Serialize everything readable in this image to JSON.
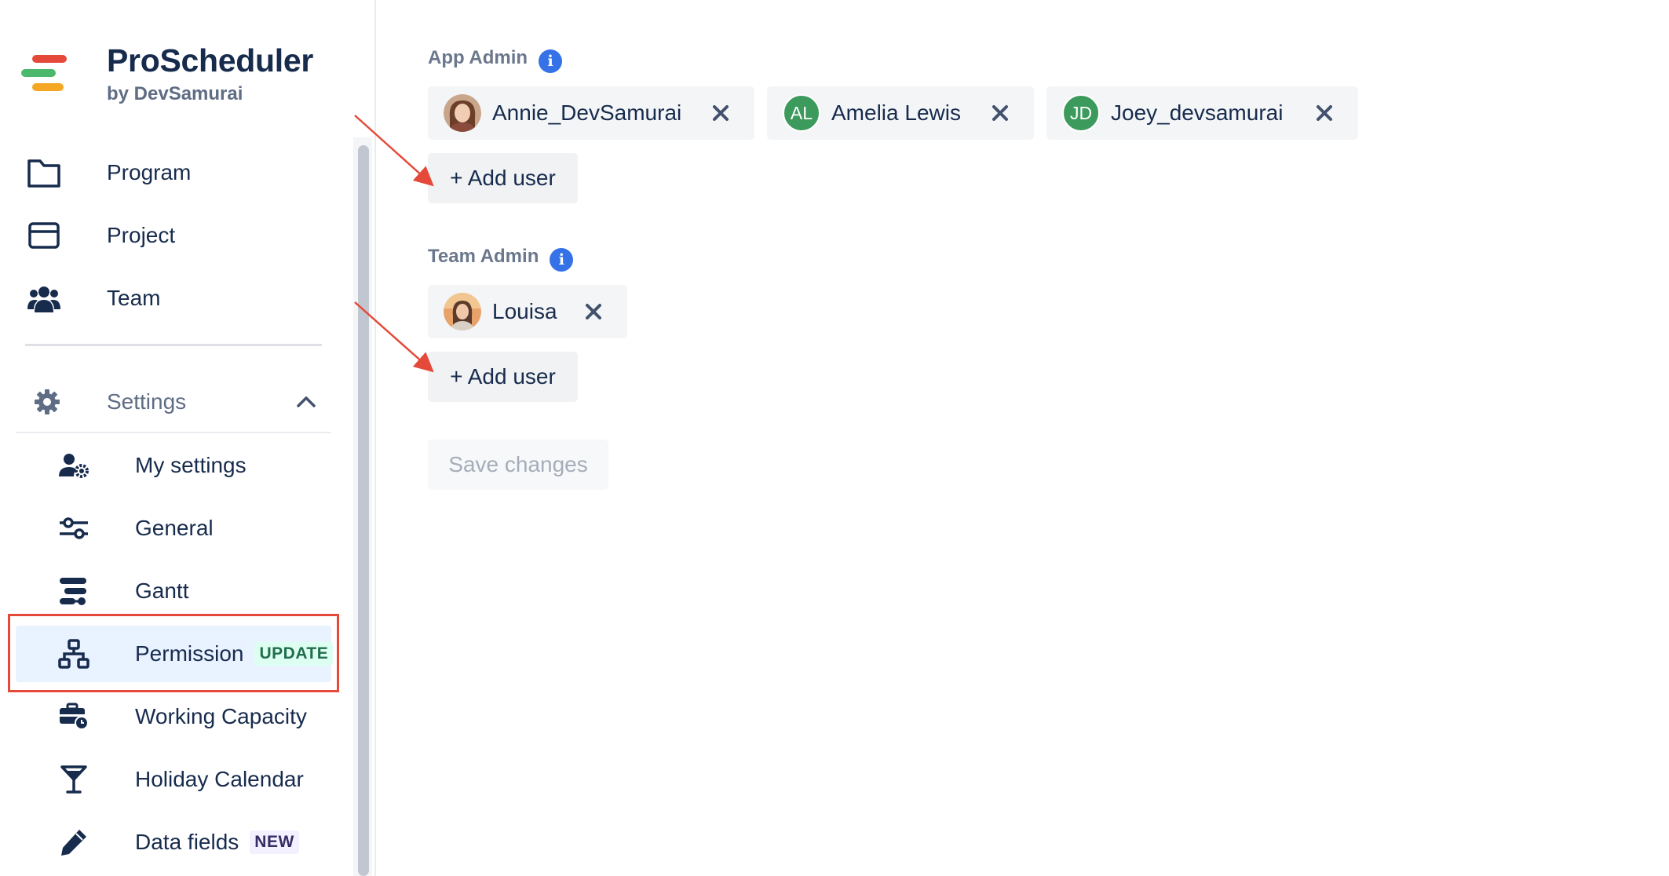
{
  "brand": {
    "title": "ProScheduler",
    "subtitle": "by DevSamurai",
    "logo_colors": [
      "#e5493a",
      "#4bb86b",
      "#f5a623"
    ]
  },
  "nav": {
    "items": [
      {
        "label": "Program",
        "icon": "folder-icon"
      },
      {
        "label": "Project",
        "icon": "window-icon"
      },
      {
        "label": "Team",
        "icon": "people-icon"
      }
    ]
  },
  "settings": {
    "label": "Settings",
    "icon": "gear-icon",
    "expanded": true,
    "items": [
      {
        "label": "My settings",
        "icon": "user-cog-icon"
      },
      {
        "label": "General",
        "icon": "sliders-icon"
      },
      {
        "label": "Gantt",
        "icon": "gantt-icon"
      },
      {
        "label": "Permission",
        "icon": "hierarchy-icon",
        "badge": "UPDATE",
        "active": true
      },
      {
        "label": "Working Capacity",
        "icon": "briefcase-clock-icon"
      },
      {
        "label": "Holiday Calendar",
        "icon": "cocktail-icon"
      },
      {
        "label": "Data fields",
        "icon": "pencil-icon",
        "badge": "NEW"
      }
    ]
  },
  "main": {
    "app_admin": {
      "title": "App Admin",
      "info": "i",
      "users": [
        {
          "name": "Annie_DevSamurai",
          "avatar": "photo"
        },
        {
          "name": "Amelia Lewis",
          "initials": "AL",
          "color": "#3b9a5c"
        },
        {
          "name": "Joey_devsamurai",
          "initials": "JD",
          "color": "#3b9a5c"
        }
      ],
      "add_label": "+ Add user"
    },
    "team_admin": {
      "title": "Team Admin",
      "info": "i",
      "users": [
        {
          "name": "Louisa",
          "avatar": "photo"
        }
      ],
      "add_label": "+ Add user"
    },
    "save_label": "Save changes"
  },
  "colors": {
    "annotation": "#e5493a",
    "info": "#3572e8",
    "text": "#172b4d",
    "muted": "#6b778c"
  }
}
